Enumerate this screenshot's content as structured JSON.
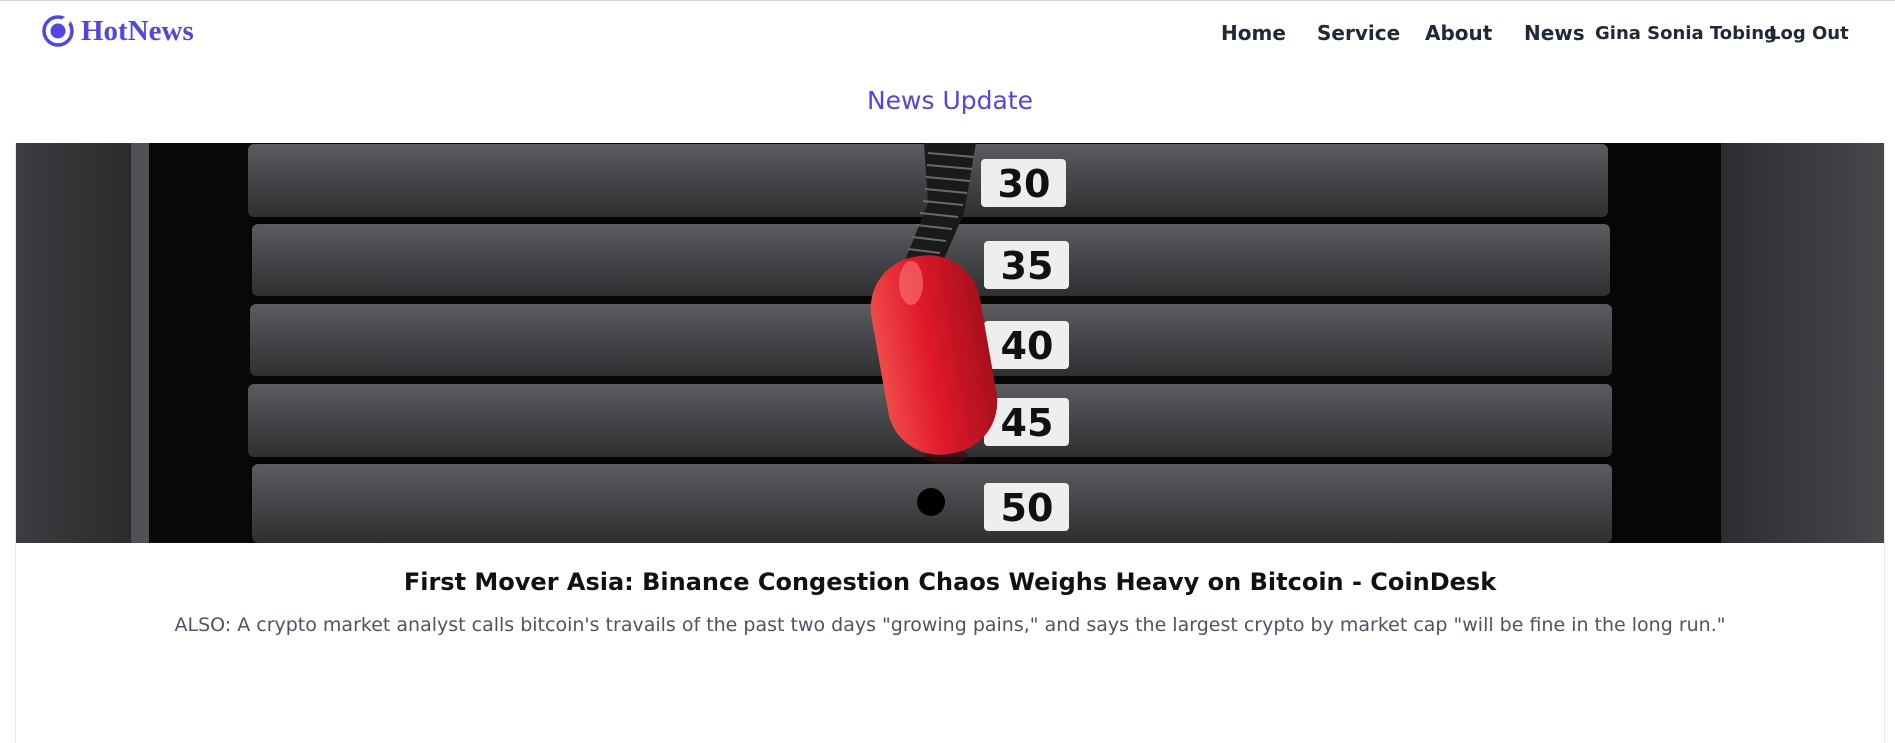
{
  "brand": {
    "name": "HotNews",
    "icon": "circle-logo-icon",
    "color": "#5046e5"
  },
  "nav": {
    "home": "Home",
    "service": "Service",
    "about": "About",
    "news": "News",
    "user": "Gina Sonia Tobing",
    "logout": "Log Out"
  },
  "section": {
    "title": "News Update"
  },
  "article": {
    "image": {
      "icon": "weight-stack-photo",
      "labels": [
        "30",
        "35",
        "40",
        "45",
        "50"
      ]
    },
    "title": "First Mover Asia: Binance Congestion Chaos Weighs Heavy on Bitcoin - CoinDesk",
    "description": "ALSO: A crypto market analyst calls bitcoin's travails of the past two days \"growing pains,\" and says the largest crypto by market cap \"will be fine in the long run.\""
  },
  "colors": {
    "accent": "#5046e5",
    "text": "#1f2937",
    "muted": "#4b5563",
    "pin": "#e0192b"
  }
}
